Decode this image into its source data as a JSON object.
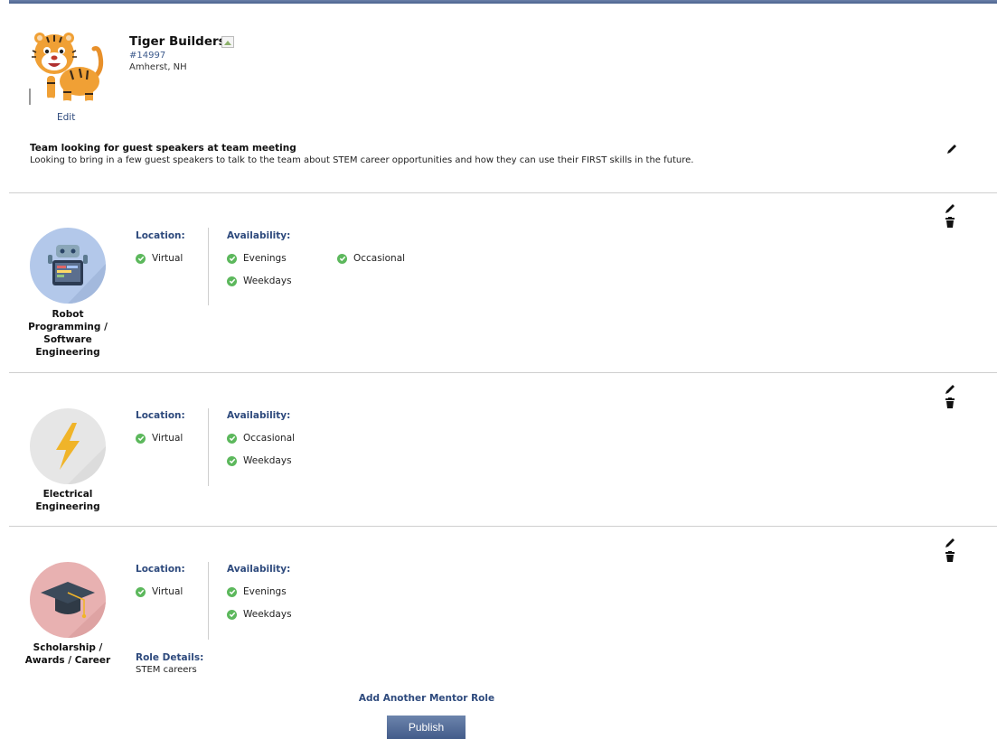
{
  "team": {
    "name": "Tiger Builders",
    "number": "#14997",
    "location": "Amherst, NH",
    "edit_label": "Edit"
  },
  "request": {
    "title": "Team looking for guest speakers at team meeting",
    "description": "Looking to bring in a few guest speakers to talk to the team about STEM career opportunities and how they can use their FIRST skills in the future."
  },
  "labels": {
    "location": "Location:",
    "availability": "Availability:",
    "role_details": "Role Details:"
  },
  "roles": [
    {
      "name_lines": [
        "Robot",
        "Programming /",
        "Software",
        "Engineering"
      ],
      "locations": [
        "Virtual"
      ],
      "availability": [
        "Evenings",
        "Weekdays",
        "Occasional"
      ],
      "icon": "robot-programming-icon",
      "icon_bg": "#b3c8ea"
    },
    {
      "name_lines": [
        "Electrical",
        "Engineering"
      ],
      "locations": [
        "Virtual"
      ],
      "availability": [
        "Occasional",
        "Weekdays"
      ],
      "icon": "lightning-bolt-icon",
      "icon_bg": "#e6e6e6"
    },
    {
      "name_lines": [
        "Scholarship /",
        "Awards / Career"
      ],
      "locations": [
        "Virtual"
      ],
      "availability": [
        "Evenings",
        "Weekdays"
      ],
      "role_details": "STEM careers",
      "icon": "graduation-cap-icon",
      "icon_bg": "#e8b1b1"
    }
  ],
  "actions": {
    "add_role": "Add Another Mentor Role",
    "publish": "Publish"
  },
  "colors": {
    "accent": "#2e4a7d",
    "check": "#5cb85c"
  }
}
